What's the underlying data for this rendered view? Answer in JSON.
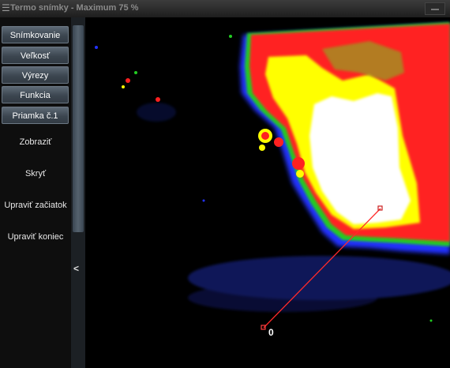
{
  "window": {
    "title": "Termo snímky - Maximum 75 %",
    "menu_icon": "hamburger-icon",
    "minimize_icon": "minimize-icon"
  },
  "sidebar": {
    "buttons": [
      {
        "label": "Snímkovanie"
      },
      {
        "label": "Veľkosť"
      },
      {
        "label": "Výrezy"
      },
      {
        "label": "Funkcia"
      },
      {
        "label": "Priamka č.1"
      }
    ],
    "links": [
      {
        "label": "Zobraziť"
      },
      {
        "label": "Skryť"
      },
      {
        "label": "Upraviť začiatok"
      },
      {
        "label": "Upraviť koniec"
      }
    ],
    "collapse_icon": "chevron-left-icon"
  },
  "thermal_image": {
    "line": {
      "start_label": "0"
    },
    "colors": {
      "line": "#ff2a2a",
      "hot": "#ff2020",
      "hottest": "#ffffff",
      "warm": "#ffff00",
      "mid": "#22cc22",
      "cool": "#2030ff"
    }
  }
}
